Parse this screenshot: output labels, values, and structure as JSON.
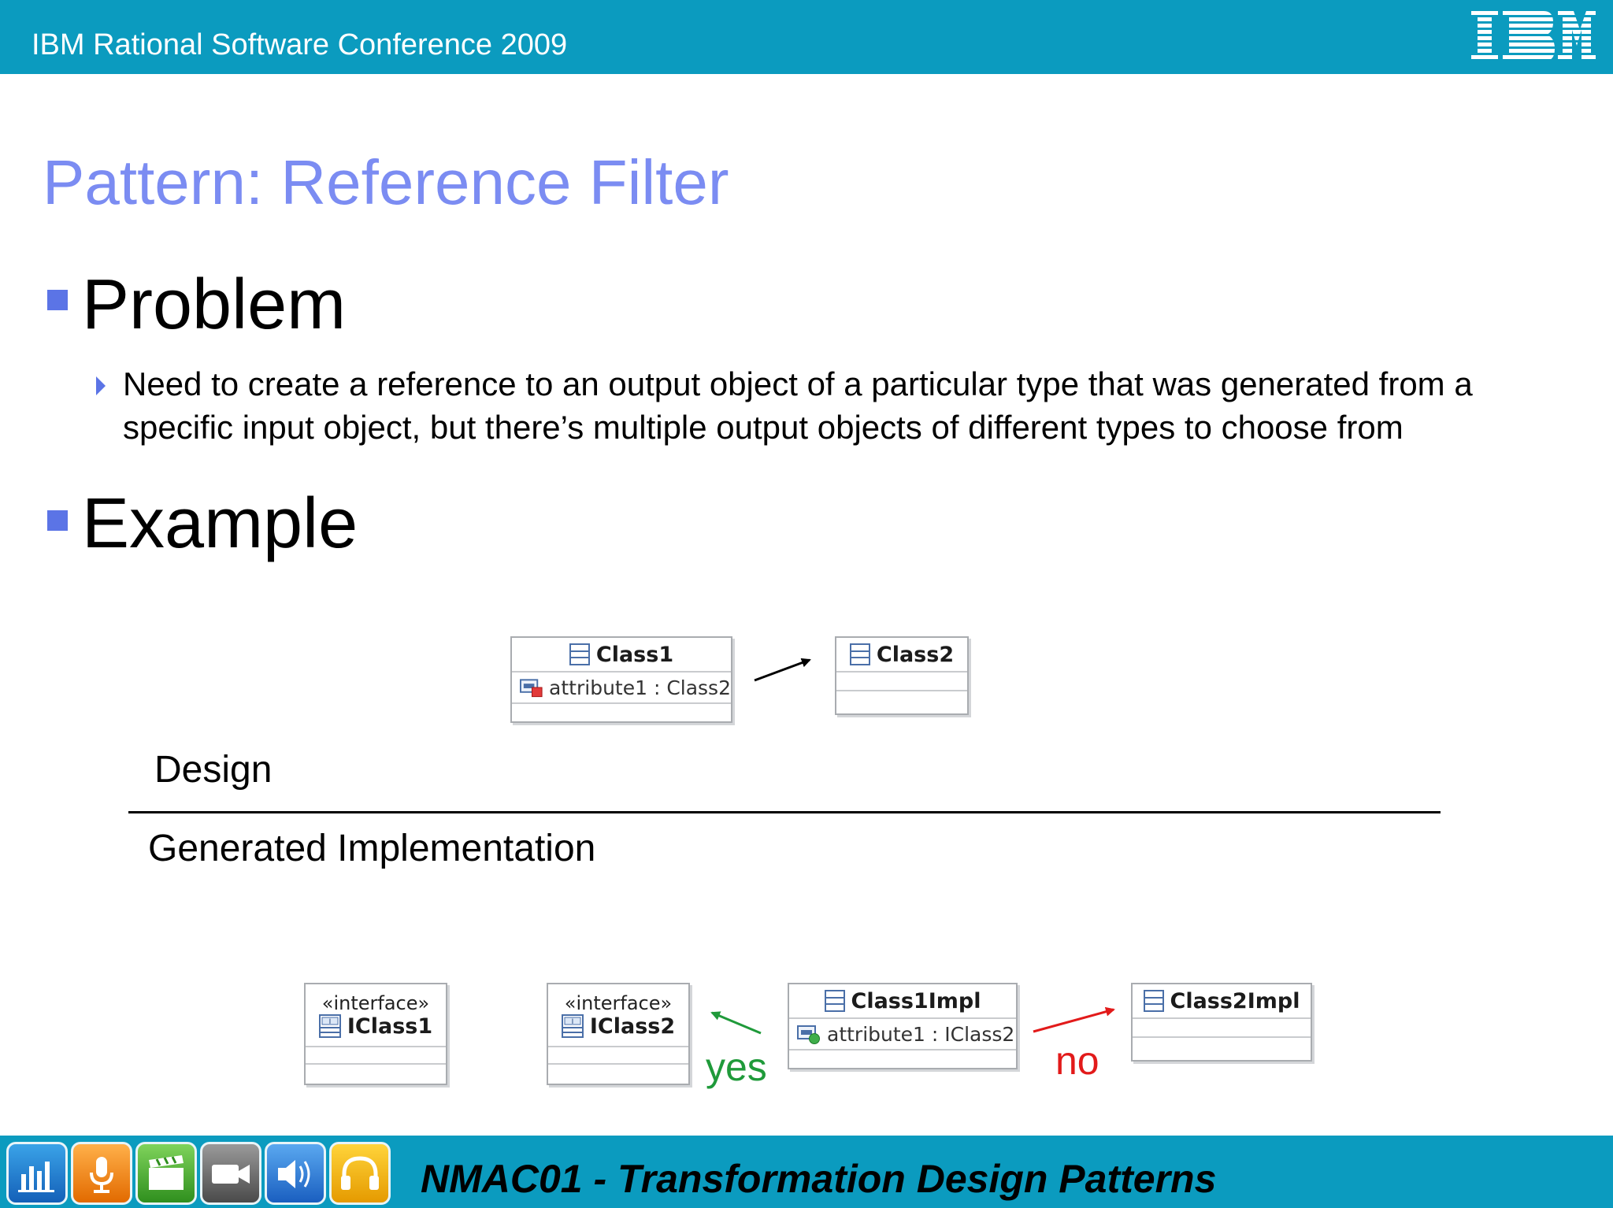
{
  "header": {
    "conference": "IBM Rational Software Conference 2009",
    "logo": "IBM"
  },
  "slide": {
    "title": "Pattern: Reference Filter",
    "problem_heading": "Problem",
    "problem_text": "Need to create a reference to an output object of a particular type that was generated from a specific input object, but there’s multiple output objects of different types to choose from",
    "example_heading": "Example"
  },
  "diagram": {
    "design_label": "Design",
    "impl_label": "Generated Implementation",
    "design": {
      "class1": {
        "name": "Class1",
        "attribute": "attribute1 : Class2"
      },
      "class2": {
        "name": "Class2"
      }
    },
    "implementation": {
      "iclass1": {
        "stereotype": "«interface»",
        "name": "IClass1"
      },
      "iclass2": {
        "stereotype": "«interface»",
        "name": "IClass2"
      },
      "class1impl": {
        "name": "Class1Impl",
        "attribute": "attribute1 : IClass2"
      },
      "class2impl": {
        "name": "Class2Impl"
      },
      "yes_label": "yes",
      "no_label": "no"
    },
    "colors": {
      "yes": "#1f9a3a",
      "no": "#e21a1a"
    }
  },
  "footer": {
    "session": "NMAC01 - Transformation Design Patterns",
    "toolbar_icons": [
      "stats-icon",
      "microphone-icon",
      "clapperboard-icon",
      "video-camera-icon",
      "speaker-icon",
      "headphones-icon"
    ]
  },
  "colors": {
    "bar": "#0b9bbf",
    "title": "#7b8cf2",
    "bullet": "#5b74e6"
  }
}
